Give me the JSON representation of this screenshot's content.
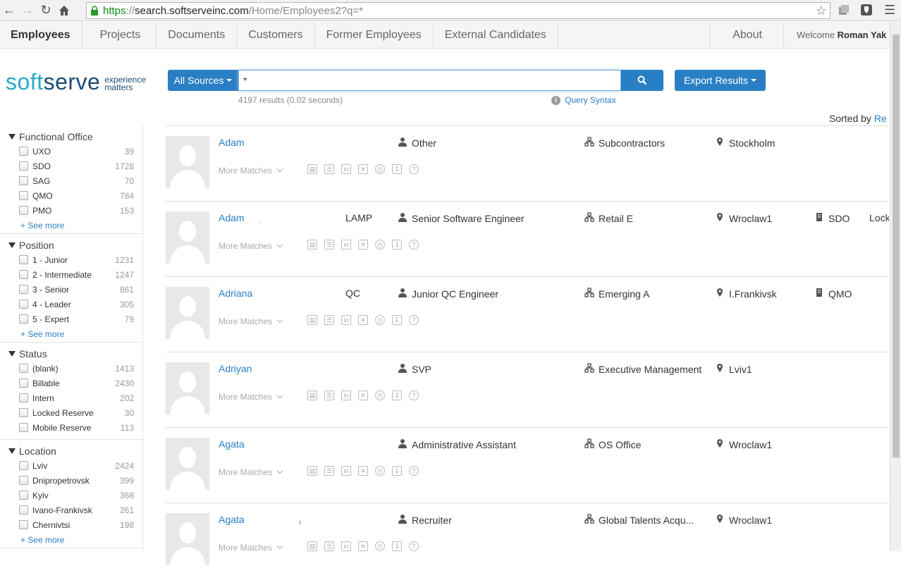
{
  "browser": {
    "url_scheme": "https",
    "url_sep": "://",
    "url_host": "search.softserveinc.com",
    "url_path": "/Home/Employees2?q=*"
  },
  "nav": {
    "tabs": [
      "Employees",
      "Projects",
      "Documents",
      "Customers",
      "Former Employees",
      "External Candidates"
    ],
    "about": "About",
    "welcome_prefix": "Welcome ",
    "welcome_user": "Roman Yak"
  },
  "logo": {
    "soft": "soft",
    "serve": "serve",
    "tag_line1": "experience",
    "tag_line2": "matters"
  },
  "search": {
    "source_label": "All Sources",
    "query": "*",
    "export_label": "Export Results",
    "results_text": "4197 results (0.02 seconds)",
    "query_syntax_label": "Query Syntax",
    "sorted_by_label": "Sorted by ",
    "sorted_by_value": "Re"
  },
  "facets": [
    {
      "title": "Functional Office",
      "items": [
        {
          "label": "UXO",
          "count": "39"
        },
        {
          "label": "SDO",
          "count": "1728"
        },
        {
          "label": "SAG",
          "count": "70"
        },
        {
          "label": "QMO",
          "count": "784"
        },
        {
          "label": "PMO",
          "count": "153"
        }
      ],
      "see_more": "+ See more"
    },
    {
      "title": "Position",
      "items": [
        {
          "label": "1 - Junior",
          "count": "1231"
        },
        {
          "label": "2 - Intermediate",
          "count": "1247"
        },
        {
          "label": "3 - Senior",
          "count": "861"
        },
        {
          "label": "4 - Leader",
          "count": "305"
        },
        {
          "label": "5 - Expert",
          "count": "79"
        }
      ],
      "see_more": "+ See more"
    },
    {
      "title": "Status",
      "items": [
        {
          "label": "(blank)",
          "count": "1413"
        },
        {
          "label": "Billable",
          "count": "2430"
        },
        {
          "label": "Intern",
          "count": "202"
        },
        {
          "label": "Locked Reserve",
          "count": "30"
        },
        {
          "label": "Mobile Reserve",
          "count": "113"
        }
      ],
      "see_more": null
    },
    {
      "title": "Location",
      "items": [
        {
          "label": "Lviv",
          "count": "2424"
        },
        {
          "label": "Dnipropetrovsk",
          "count": "399"
        },
        {
          "label": "Kyiv",
          "count": "368"
        },
        {
          "label": "Ivano-Frankivsk",
          "count": "261"
        },
        {
          "label": "Chernivtsi",
          "count": "198"
        }
      ],
      "see_more": "+ See more"
    }
  ],
  "results": [
    {
      "name": "Adam",
      "extra": "",
      "mark": "",
      "position": "Other",
      "unit": "Subcontractors",
      "location": "Stockholm",
      "office": "",
      "status": ""
    },
    {
      "name": "Adam",
      "extra": "LAMP",
      "mark": ".",
      "position": "Senior Software Engineer",
      "unit": "Retail E",
      "location": "Wroclaw1",
      "office": "SDO",
      "status": "Lock"
    },
    {
      "name": "Adriana",
      "extra": "QC",
      "mark": "",
      "position": "Junior QC Engineer",
      "unit": "Emerging A",
      "location": "I.Frankivsk",
      "office": "QMO",
      "status": ""
    },
    {
      "name": "Adriyan",
      "extra": "",
      "mark": "",
      "position": "SVP",
      "unit": "Executive Management",
      "location": "Lviv1",
      "office": "",
      "status": ""
    },
    {
      "name": "Agata",
      "extra": "",
      "mark": "",
      "position": "Administrative Assistant",
      "unit": "OS Office",
      "location": "Wroclaw1",
      "office": "",
      "status": ""
    },
    {
      "name": "Agata",
      "extra": "",
      "mark": "ı",
      "position": "Recruiter",
      "unit": "Global Talents Acqu...",
      "location": "Wroclaw1",
      "office": "",
      "status": ""
    }
  ],
  "more_matches_label": "More Matches"
}
